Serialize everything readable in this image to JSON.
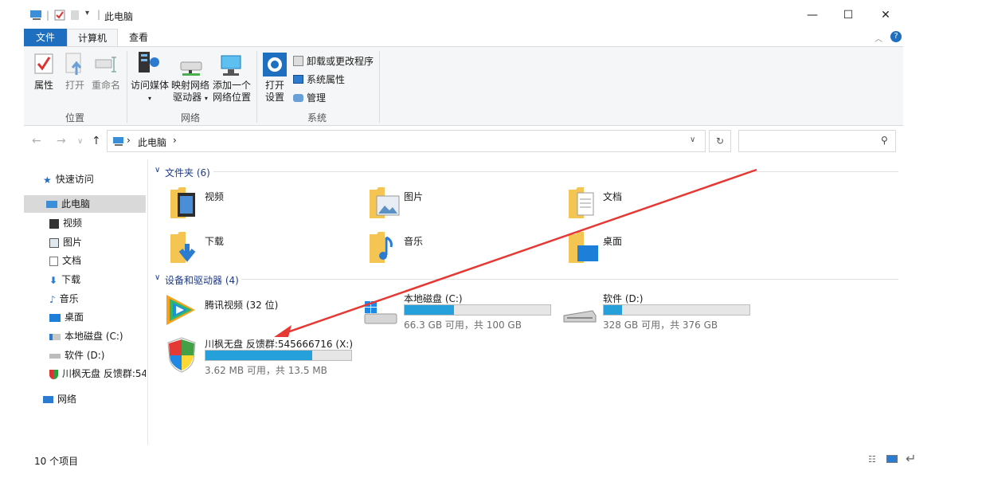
{
  "window": {
    "title": "此电脑",
    "controls": {
      "minimize": "—",
      "maximize": "☐",
      "close": "✕"
    }
  },
  "tabs": {
    "file": "文件",
    "computer": "计算机",
    "view": "查看"
  },
  "ribbon": {
    "location": {
      "label": "位置",
      "items": [
        "属性",
        "打开",
        "重命名"
      ]
    },
    "network": {
      "label": "网络",
      "access_media": "访问媒体",
      "map_drive_1": "映射网络",
      "map_drive_2": "驱动器",
      "add_location_1": "添加一个",
      "add_location_2": "网络位置"
    },
    "system": {
      "label": "系统",
      "open_settings_1": "打开",
      "open_settings_2": "设置",
      "uninstall": "卸载或更改程序",
      "system_props": "系统属性",
      "manage": "管理"
    }
  },
  "address": {
    "path_root": "此电脑",
    "separator": "›",
    "search_placeholder": ""
  },
  "sidebar": {
    "items": [
      {
        "label": "快速访问",
        "icon": "star-icon"
      },
      {
        "label": "此电脑",
        "icon": "computer-icon",
        "selected": true
      },
      {
        "label": "视频",
        "icon": "video-icon"
      },
      {
        "label": "图片",
        "icon": "picture-icon"
      },
      {
        "label": "文档",
        "icon": "document-icon"
      },
      {
        "label": "下载",
        "icon": "download-icon"
      },
      {
        "label": "音乐",
        "icon": "music-icon"
      },
      {
        "label": "桌面",
        "icon": "desktop-icon"
      },
      {
        "label": "本地磁盘 (C:)",
        "icon": "drive-c-icon"
      },
      {
        "label": "软件 (D:)",
        "icon": "drive-icon"
      },
      {
        "label": "川枫无盘 反馈群:54",
        "icon": "shield-icon"
      },
      {
        "label": "网络",
        "icon": "network-icon"
      }
    ]
  },
  "folders": {
    "title": "文件夹 (6)",
    "items": [
      {
        "label": "视频"
      },
      {
        "label": "图片"
      },
      {
        "label": "文档"
      },
      {
        "label": "下载"
      },
      {
        "label": "音乐"
      },
      {
        "label": "桌面"
      }
    ]
  },
  "devices": {
    "title": "设备和驱动器 (4)",
    "items": [
      {
        "name": "腾讯视频 (32 位)",
        "info": "",
        "fill": null
      },
      {
        "name": "本地磁盘 (C:)",
        "info": "66.3 GB 可用，共 100 GB",
        "fill": 0.337
      },
      {
        "name": "软件 (D:)",
        "info": "328 GB 可用，共 376 GB",
        "fill": 0.128
      },
      {
        "name": "川枫无盘 反馈群:545666716 (X:)",
        "info": "3.62 MB 可用，共 13.5 MB",
        "fill": 0.732
      }
    ]
  },
  "status": {
    "count": "10 个项目"
  },
  "colors": {
    "accent": "#1e6fbf",
    "bar_fill": "#26a0da",
    "arrow": "#e53935"
  }
}
